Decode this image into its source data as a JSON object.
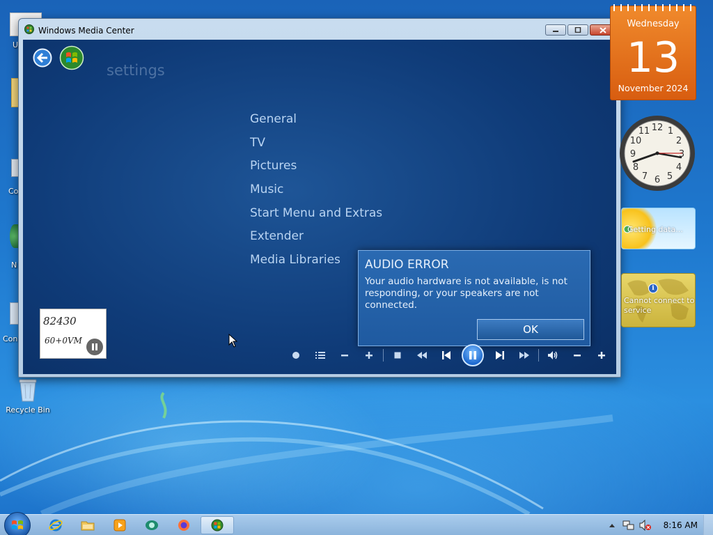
{
  "desktop": {
    "partial_labels": [
      "U",
      "Co",
      "N",
      "Con"
    ],
    "recycle_bin_label": "Recycle Bin"
  },
  "window": {
    "title": "Windows Media Center",
    "heading": "settings",
    "menu": [
      "General",
      "TV",
      "Pictures",
      "Music",
      "Start Menu and Extras",
      "Extender",
      "Media Libraries"
    ]
  },
  "thumbnail": {
    "line1": "82430",
    "line2": "60+0VM"
  },
  "dialog": {
    "title": "AUDIO ERROR",
    "message": "Your audio hardware is not available, is not responding, or your speakers are not connected.",
    "ok_label": "OK"
  },
  "transport_controls": [
    "record-icon",
    "guide-icon",
    "channel-down-icon",
    "channel-up-icon",
    "stop-icon",
    "rewind-icon",
    "skip-back-icon",
    "pause-icon",
    "skip-forward-icon",
    "fast-forward-icon",
    "mute-icon",
    "volume-down-icon",
    "volume-up-icon"
  ],
  "gadgets": {
    "calendar": {
      "weekday": "Wednesday",
      "day": "13",
      "month_year": "November 2024"
    },
    "clock": {
      "numerals": [
        "12",
        "1",
        "2",
        "3",
        "4",
        "5",
        "6",
        "7",
        "8",
        "9",
        "10",
        "11"
      ]
    },
    "weather": {
      "status": "Getting data..."
    },
    "feed": {
      "status": "Cannot connect to service"
    }
  },
  "taskbar": {
    "time": "8:16 AM",
    "apps": [
      "internet-explorer-icon",
      "file-explorer-icon",
      "media-player-icon",
      "messenger-icon",
      "firefox-icon",
      "media-center-icon"
    ]
  },
  "colors": {
    "desktop_blue": "#1f79cf",
    "wmc_blue": "#0f3b78",
    "menu_text": "#b9d4f2",
    "calendar_orange": "#e7741e",
    "feed_gold": "#d9c24f"
  }
}
